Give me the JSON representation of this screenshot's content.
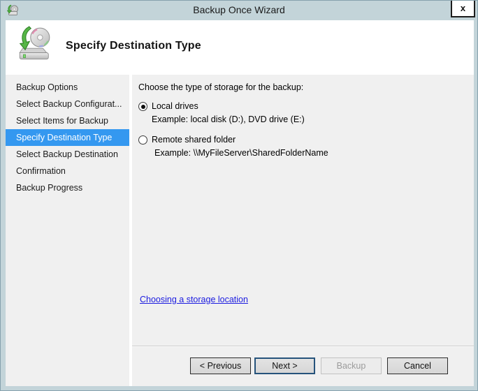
{
  "window": {
    "title": "Backup Once Wizard",
    "close_label": "x"
  },
  "header": {
    "title": "Specify Destination Type"
  },
  "sidebar": {
    "items": [
      {
        "label": "Backup Options",
        "active": false
      },
      {
        "label": "Select Backup Configurat...",
        "active": false
      },
      {
        "label": "Select Items for Backup",
        "active": false
      },
      {
        "label": "Specify Destination Type",
        "active": true
      },
      {
        "label": "Select Backup Destination",
        "active": false
      },
      {
        "label": "Confirmation",
        "active": false
      },
      {
        "label": "Backup Progress",
        "active": false
      }
    ]
  },
  "content": {
    "prompt": "Choose the type of storage for the backup:",
    "options": [
      {
        "label": "Local drives",
        "example": "Example: local disk (D:), DVD drive (E:)",
        "selected": true
      },
      {
        "label": "Remote shared folder",
        "example": "Example: \\\\MyFileServer\\SharedFolderName",
        "selected": false
      }
    ],
    "help_link": "Choosing a storage location"
  },
  "buttons": {
    "previous": "< Previous",
    "next": "Next >",
    "backup": "Backup",
    "cancel": "Cancel"
  },
  "colors": {
    "frame": "#c3d4d9",
    "highlight": "#3498f0",
    "link": "#1b1be0",
    "next_border": "#26537c"
  }
}
